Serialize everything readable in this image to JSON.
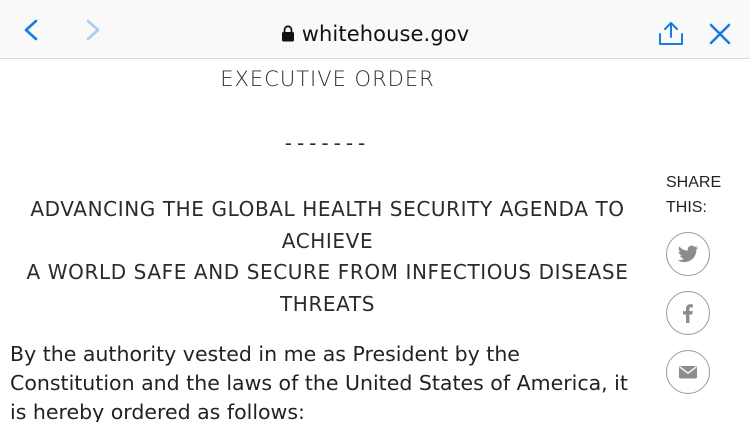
{
  "browser": {
    "url": "whitehouse.gov"
  },
  "document": {
    "order_type": "EXECUTIVE ORDER",
    "divider": "-------",
    "title_lines": [
      "ADVANCING THE GLOBAL HEALTH SECURITY AGENDA TO",
      "ACHIEVE",
      "A WORLD SAFE AND SECURE FROM INFECTIOUS DISEASE",
      "THREATS"
    ],
    "body_lines": [
      "By the authority vested in me as President by the",
      "Constitution and the laws of the United States of America, it",
      "is hereby ordered as follows:"
    ]
  },
  "share": {
    "label_lines": [
      "SHARE",
      "THIS:"
    ],
    "buttons": [
      "twitter-icon",
      "facebook-icon",
      "email-icon"
    ]
  },
  "colors": {
    "accent_blue": "#1a7ce0",
    "disabled_blue": "#a9cdf2",
    "icon_gray": "#8c8c8c",
    "circle_border": "#9a9a9a"
  }
}
